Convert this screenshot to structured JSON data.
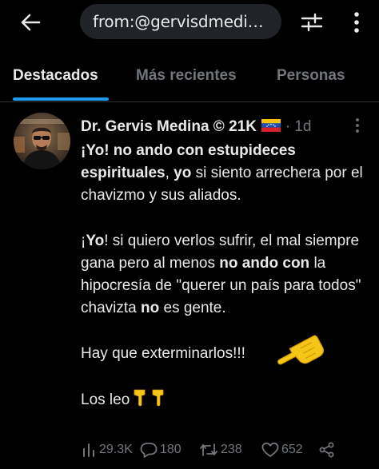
{
  "search": {
    "query": "from:@gervisdmedin…"
  },
  "tabs": [
    {
      "label": "Destacados",
      "active": true
    },
    {
      "label": "Más recientes",
      "active": false
    },
    {
      "label": "Personas",
      "active": false
    }
  ],
  "tweet": {
    "author_name": "Dr. Gervis Medina © 21K",
    "flag_icon": "venezuela-flag",
    "time": "1d",
    "body": {
      "p1_b1": "¡Yo! no ando con estupideces espirituales",
      "p1_t1": ", ",
      "p1_b2": "yo",
      "p1_t2": " si siento arrechera por el chavizmo y sus aliados.",
      "p2_t1": "¡",
      "p2_b1": "Yo",
      "p2_t2": "! si quiero verlos sufrir, el mal siempre gana pero al menos ",
      "p2_b2": "no ando con",
      "p2_t3": " la hipocresía de \"querer un país para todos\" chavizta ",
      "p2_b3": "no",
      "p2_t4": " es gente.",
      "p3": "Hay que exterminarlos!!!",
      "p4": "Los leo"
    },
    "emoji": {
      "side_hand": "backhand-index-pointing-left",
      "inline_hands": "backhand-index-pointing-down"
    },
    "stats": {
      "views": "29.3K",
      "replies": "180",
      "retweets": "238",
      "likes": "652"
    }
  },
  "colors": {
    "background": "#000000",
    "text": "#e7e9ea",
    "muted": "#71767b",
    "accent": "#1d9bf0",
    "search_bg": "#202327"
  }
}
